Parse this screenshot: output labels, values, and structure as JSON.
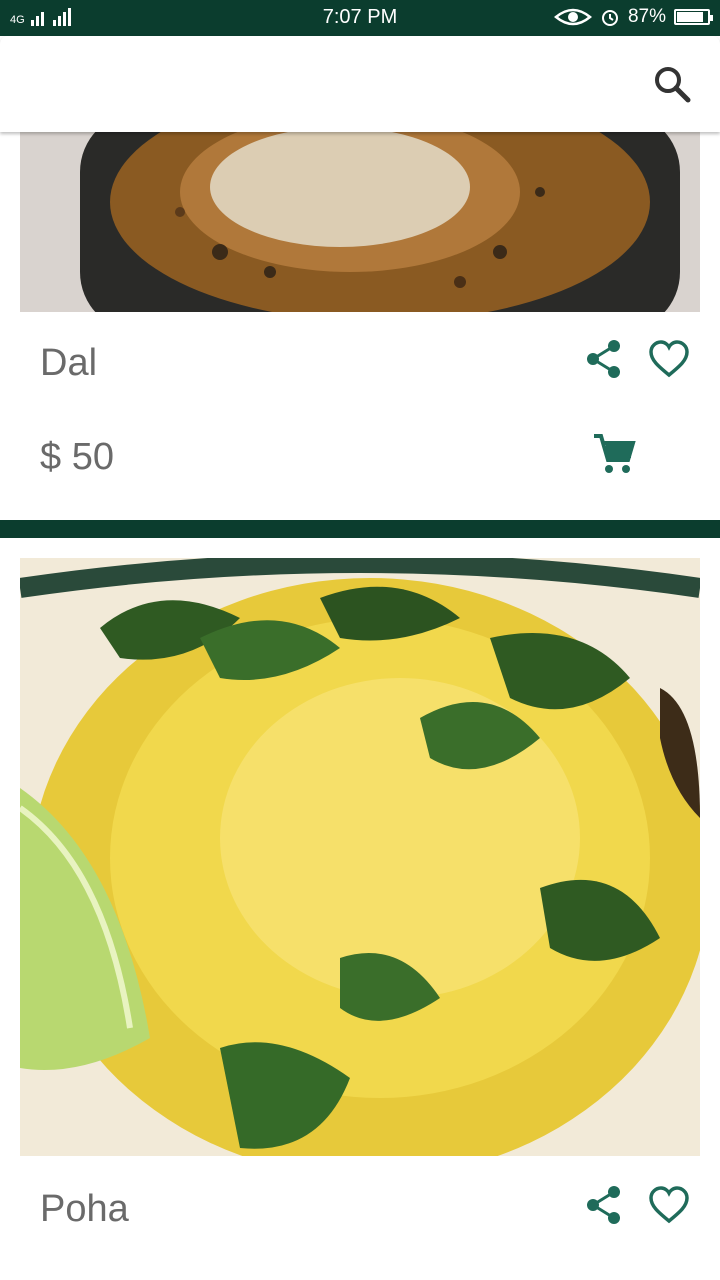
{
  "status": {
    "network": "4G",
    "time": "7:07 PM",
    "battery": "87%",
    "battery_level": 0.87
  },
  "search": {
    "icon": "search-icon"
  },
  "items": [
    {
      "name": "Dal",
      "price": "$ 50"
    },
    {
      "name": "Poha",
      "price": ""
    }
  ],
  "colors": {
    "accent": "#1f6b5a",
    "status_bar": "#0b3d2e",
    "text": "#6a6a6a"
  }
}
